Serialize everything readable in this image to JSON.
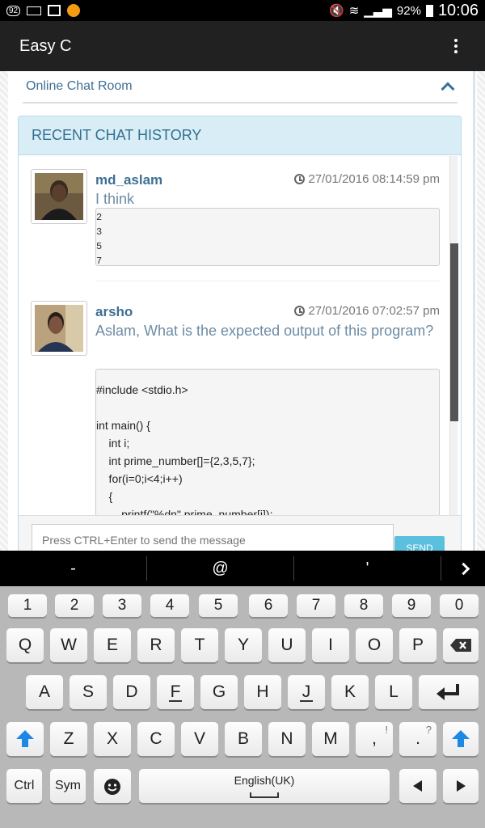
{
  "status_bar": {
    "left_icons": [
      "notification-92-icon",
      "keyboard-icon",
      "image-icon",
      "squirrel-icon"
    ],
    "left_badge": "92",
    "battery_pct": "92%",
    "time": "10:06"
  },
  "app_bar": {
    "title": "Easy C",
    "menu_icon": "more-vert-icon"
  },
  "chat_room": {
    "title": "Online Chat Room"
  },
  "panel": {
    "title": "RECENT CHAT HISTORY"
  },
  "messages": [
    {
      "user": "md_aslam",
      "time": "27/01/2016 08:14:59 pm",
      "text": "I think",
      "code": [
        "2",
        "3",
        "5",
        "7"
      ]
    },
    {
      "user": "arsho",
      "time": "27/01/2016 07:02:57 pm",
      "text": "Aslam, What is the expected output of this program?",
      "code": [
        "#include <stdio.h>",
        "",
        "int main() {",
        "    int i;",
        "    int prime_number[]={2,3,5,7};",
        "    for(i=0;i<4;i++)",
        "    {",
        "        printf(\"%dn\",prime_number[i]);"
      ]
    }
  ],
  "composer": {
    "placeholder": "Press CTRL+Enter to send the message",
    "send_label": "SEND"
  },
  "keyboard": {
    "suggestions": [
      "-",
      "@",
      "'"
    ],
    "row_numbers": [
      "1",
      "2",
      "3",
      "4",
      "5",
      "6",
      "7",
      "8",
      "9",
      "0"
    ],
    "row1": [
      "Q",
      "W",
      "E",
      "R",
      "T",
      "Y",
      "U",
      "I",
      "O",
      "P"
    ],
    "row2": [
      "A",
      "S",
      "D",
      "F",
      "G",
      "H",
      "J",
      "K",
      "L"
    ],
    "row3": [
      "Z",
      "X",
      "C",
      "V",
      "B",
      "N",
      "M"
    ],
    "comma": ",",
    "comma_alt": "!",
    "period": ".",
    "period_alt": "?",
    "ctrl": "Ctrl",
    "sym": "Sym",
    "space_label": "English(UK)"
  }
}
